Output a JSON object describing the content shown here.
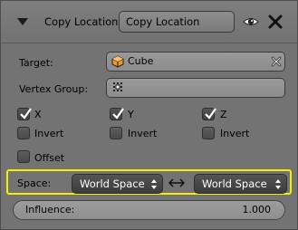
{
  "header": {
    "modifier_type": "Copy Location",
    "name_value": "Copy Location"
  },
  "target": {
    "label": "Target:",
    "value": "Cube",
    "icon": "cube-icon"
  },
  "vertex_group": {
    "label": "Vertex Group:",
    "value": "",
    "icon": "vertex-group-icon"
  },
  "axes": [
    {
      "label": "X",
      "checked": true
    },
    {
      "label": "Y",
      "checked": true
    },
    {
      "label": "Z",
      "checked": true
    }
  ],
  "invert": [
    {
      "label": "Invert",
      "checked": false
    },
    {
      "label": "Invert",
      "checked": false
    },
    {
      "label": "Invert",
      "checked": false
    }
  ],
  "offset": {
    "label": "Offset",
    "checked": false
  },
  "space": {
    "label": "Space:",
    "owner_space": "World Space",
    "target_space": "World Space",
    "highlight_color": "#f0f000"
  },
  "influence": {
    "label": "Influence:",
    "value": "1.000"
  }
}
